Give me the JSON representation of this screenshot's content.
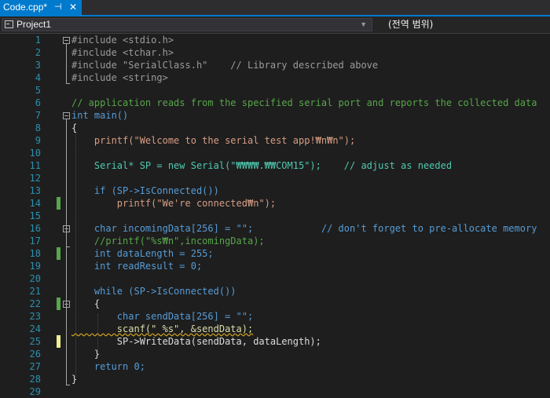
{
  "tab": {
    "title": "Code.cpp*",
    "pin": "⊣",
    "close": "✕"
  },
  "navbar": {
    "project": "Project1",
    "scope": "(전역 범위)"
  },
  "editor": {
    "lines": [
      {
        "n": "1",
        "text": "#include <stdio.h>"
      },
      {
        "n": "2",
        "text": "#include <tchar.h>"
      },
      {
        "n": "3",
        "text": "#include \"SerialClass.h\"    // Library described above"
      },
      {
        "n": "4",
        "text": "#include <string>"
      },
      {
        "n": "5",
        "text": ""
      },
      {
        "n": "6",
        "text": "// application reads from the specified serial port and reports the collected data"
      },
      {
        "n": "7",
        "text": "int main()"
      },
      {
        "n": "8",
        "text": "{"
      },
      {
        "n": "9",
        "text": "    printf(\"Welcome to the serial test app!₩n₩n\");"
      },
      {
        "n": "10",
        "text": ""
      },
      {
        "n": "11",
        "text": "    Serial* SP = new Serial(\"₩₩₩₩.₩₩COM15\");    // adjust as needed"
      },
      {
        "n": "12",
        "text": ""
      },
      {
        "n": "13",
        "text": "    if (SP->IsConnected())"
      },
      {
        "n": "14",
        "text": "        printf(\"We're connected₩n\");"
      },
      {
        "n": "15",
        "text": ""
      },
      {
        "n": "16",
        "text": "    char incomingData[256] = \"\";            // don't forget to pre-allocate memory"
      },
      {
        "n": "17",
        "text": "    //printf(\"%s₩n\",incomingData);"
      },
      {
        "n": "18",
        "text": "    int dataLength = 255;"
      },
      {
        "n": "19",
        "text": "    int readResult = 0;"
      },
      {
        "n": "20",
        "text": ""
      },
      {
        "n": "21",
        "text": "    while (SP->IsConnected())"
      },
      {
        "n": "22",
        "text": "    {"
      },
      {
        "n": "23",
        "text": "        char sendData[256] = \"\";"
      },
      {
        "n": "24",
        "text": "        scanf(\" %s\", &sendData);"
      },
      {
        "n": "25",
        "text": "        SP->WriteData(sendData, dataLength);"
      },
      {
        "n": "26",
        "text": "    }"
      },
      {
        "n": "27",
        "text": "    return 0;"
      },
      {
        "n": "28",
        "text": "}"
      },
      {
        "n": "29",
        "text": ""
      }
    ]
  },
  "colors": {
    "accent": "#007acc",
    "keyword": "#569cd6",
    "string": "#d69d85",
    "comment": "#57a64a",
    "line_number": "#2b91af",
    "change_saved": "#57a64a",
    "change_unsaved": "#efef91"
  }
}
